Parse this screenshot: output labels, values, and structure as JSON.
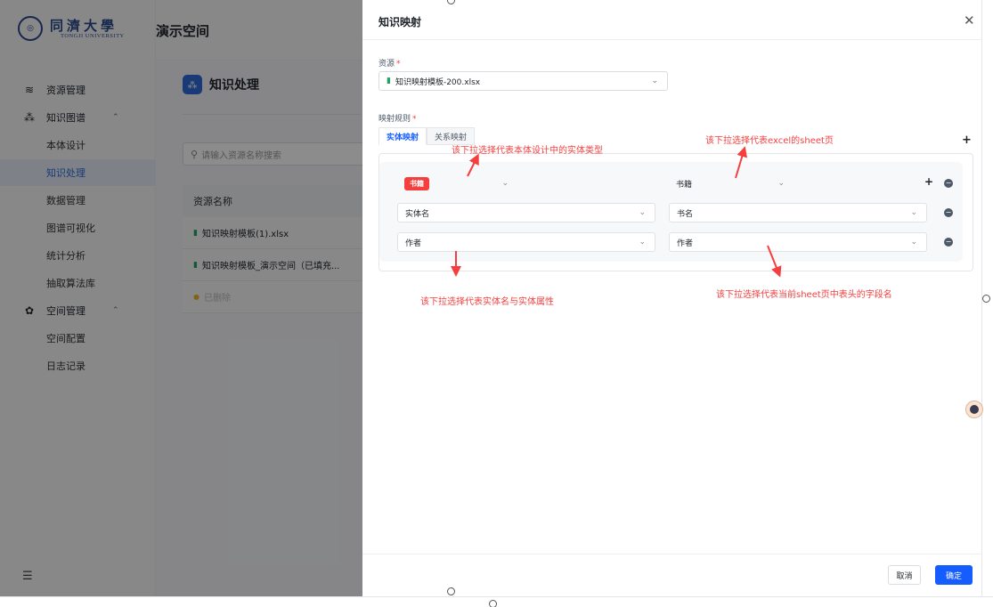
{
  "sidebar": {
    "logo": {
      "cn": "同濟大學",
      "en": "TONGJI UNIVERSITY"
    },
    "items": [
      {
        "label": "资源管理",
        "icon": "layers-icon"
      },
      {
        "label": "知识图谱",
        "icon": "graph-icon",
        "expanded": true
      },
      {
        "label": "本体设计"
      },
      {
        "label": "知识处理",
        "active": true
      },
      {
        "label": "数据管理"
      },
      {
        "label": "图谱可视化"
      },
      {
        "label": "统计分析"
      },
      {
        "label": "抽取算法库"
      },
      {
        "label": "空间管理",
        "icon": "gear-icon",
        "expanded": true
      },
      {
        "label": "空间配置"
      },
      {
        "label": "日志记录"
      }
    ]
  },
  "header": {
    "space_title": "演示空间"
  },
  "main": {
    "title": "知识处理",
    "search_placeholder": "请输入资源名称搜索",
    "table_header": "资源名称",
    "rows": [
      "知识映射模板(1).xlsx",
      "知识映射模板_演示空间（已填充...",
      "已删除"
    ]
  },
  "drawer": {
    "title": "知识映射",
    "source_label": "资源",
    "source_value": "知识映射模板-200.xlsx",
    "rules_label": "映射规则",
    "tabs": [
      "实体映射",
      "关系映射"
    ],
    "active_tab": "实体映射",
    "entity_type_tag": "书籍",
    "sheet_value": "书籍",
    "rows": [
      {
        "left": "实体名",
        "right": "书名"
      },
      {
        "left": "作者",
        "right": "作者"
      }
    ],
    "annotations": {
      "entity_type": "该下拉选择代表本体设计中的实体类型",
      "sheet": "该下拉选择代表excel的sheet页",
      "entity_attr": "该下拉选择代表实体名与实体属性",
      "header_field": "该下拉选择代表当前sheet页中表头的字段名"
    },
    "cancel_label": "取消",
    "ok_label": "确定"
  },
  "colors": {
    "primary": "#165dff",
    "danger": "#f53f3f",
    "excel_green": "#21a366"
  }
}
